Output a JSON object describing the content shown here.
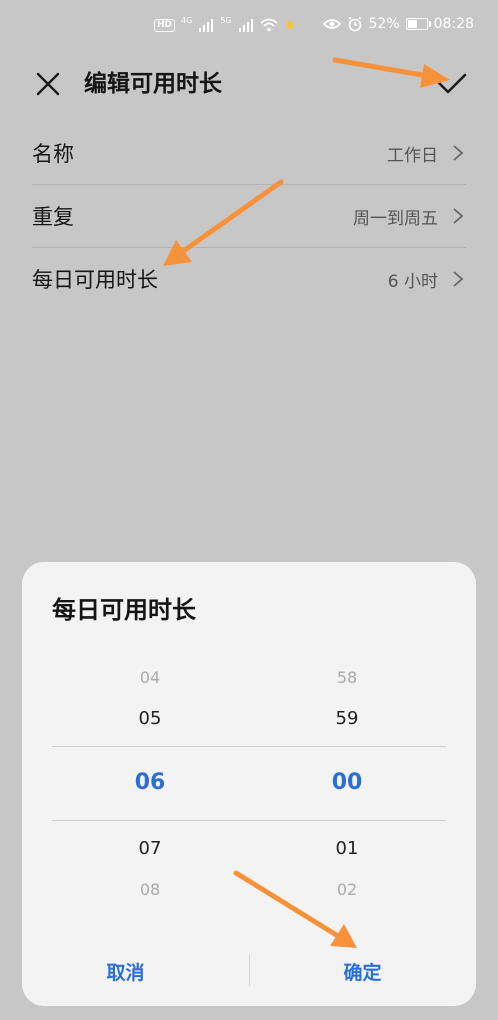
{
  "status_bar": {
    "hd": "HD",
    "net1": "4G",
    "net2": "5G",
    "battery_percent": "52%",
    "battery_level": 0.52,
    "time": "08:28"
  },
  "header": {
    "title": "编辑可用时长",
    "close_icon": "close-icon",
    "confirm_icon": "check-icon"
  },
  "settings": {
    "items": [
      {
        "label": "名称",
        "value": "工作日"
      },
      {
        "label": "重复",
        "value": "周一到周五"
      },
      {
        "label": "每日可用时长",
        "value": "6 小时"
      }
    ]
  },
  "dialog": {
    "title": "每日可用时长",
    "hours": {
      "far_above": "04",
      "above": "05",
      "selected": "06",
      "below": "07",
      "far_below": "08"
    },
    "minutes": {
      "far_above": "58",
      "above": "59",
      "selected": "00",
      "below": "01",
      "far_below": "02"
    },
    "cancel_label": "取消",
    "ok_label": "确定"
  },
  "colors": {
    "accent": "#2b6fd6",
    "arrow": "#f7923a",
    "scrim": "#c7c7c7",
    "dialog_bg": "#f3f3f3"
  }
}
